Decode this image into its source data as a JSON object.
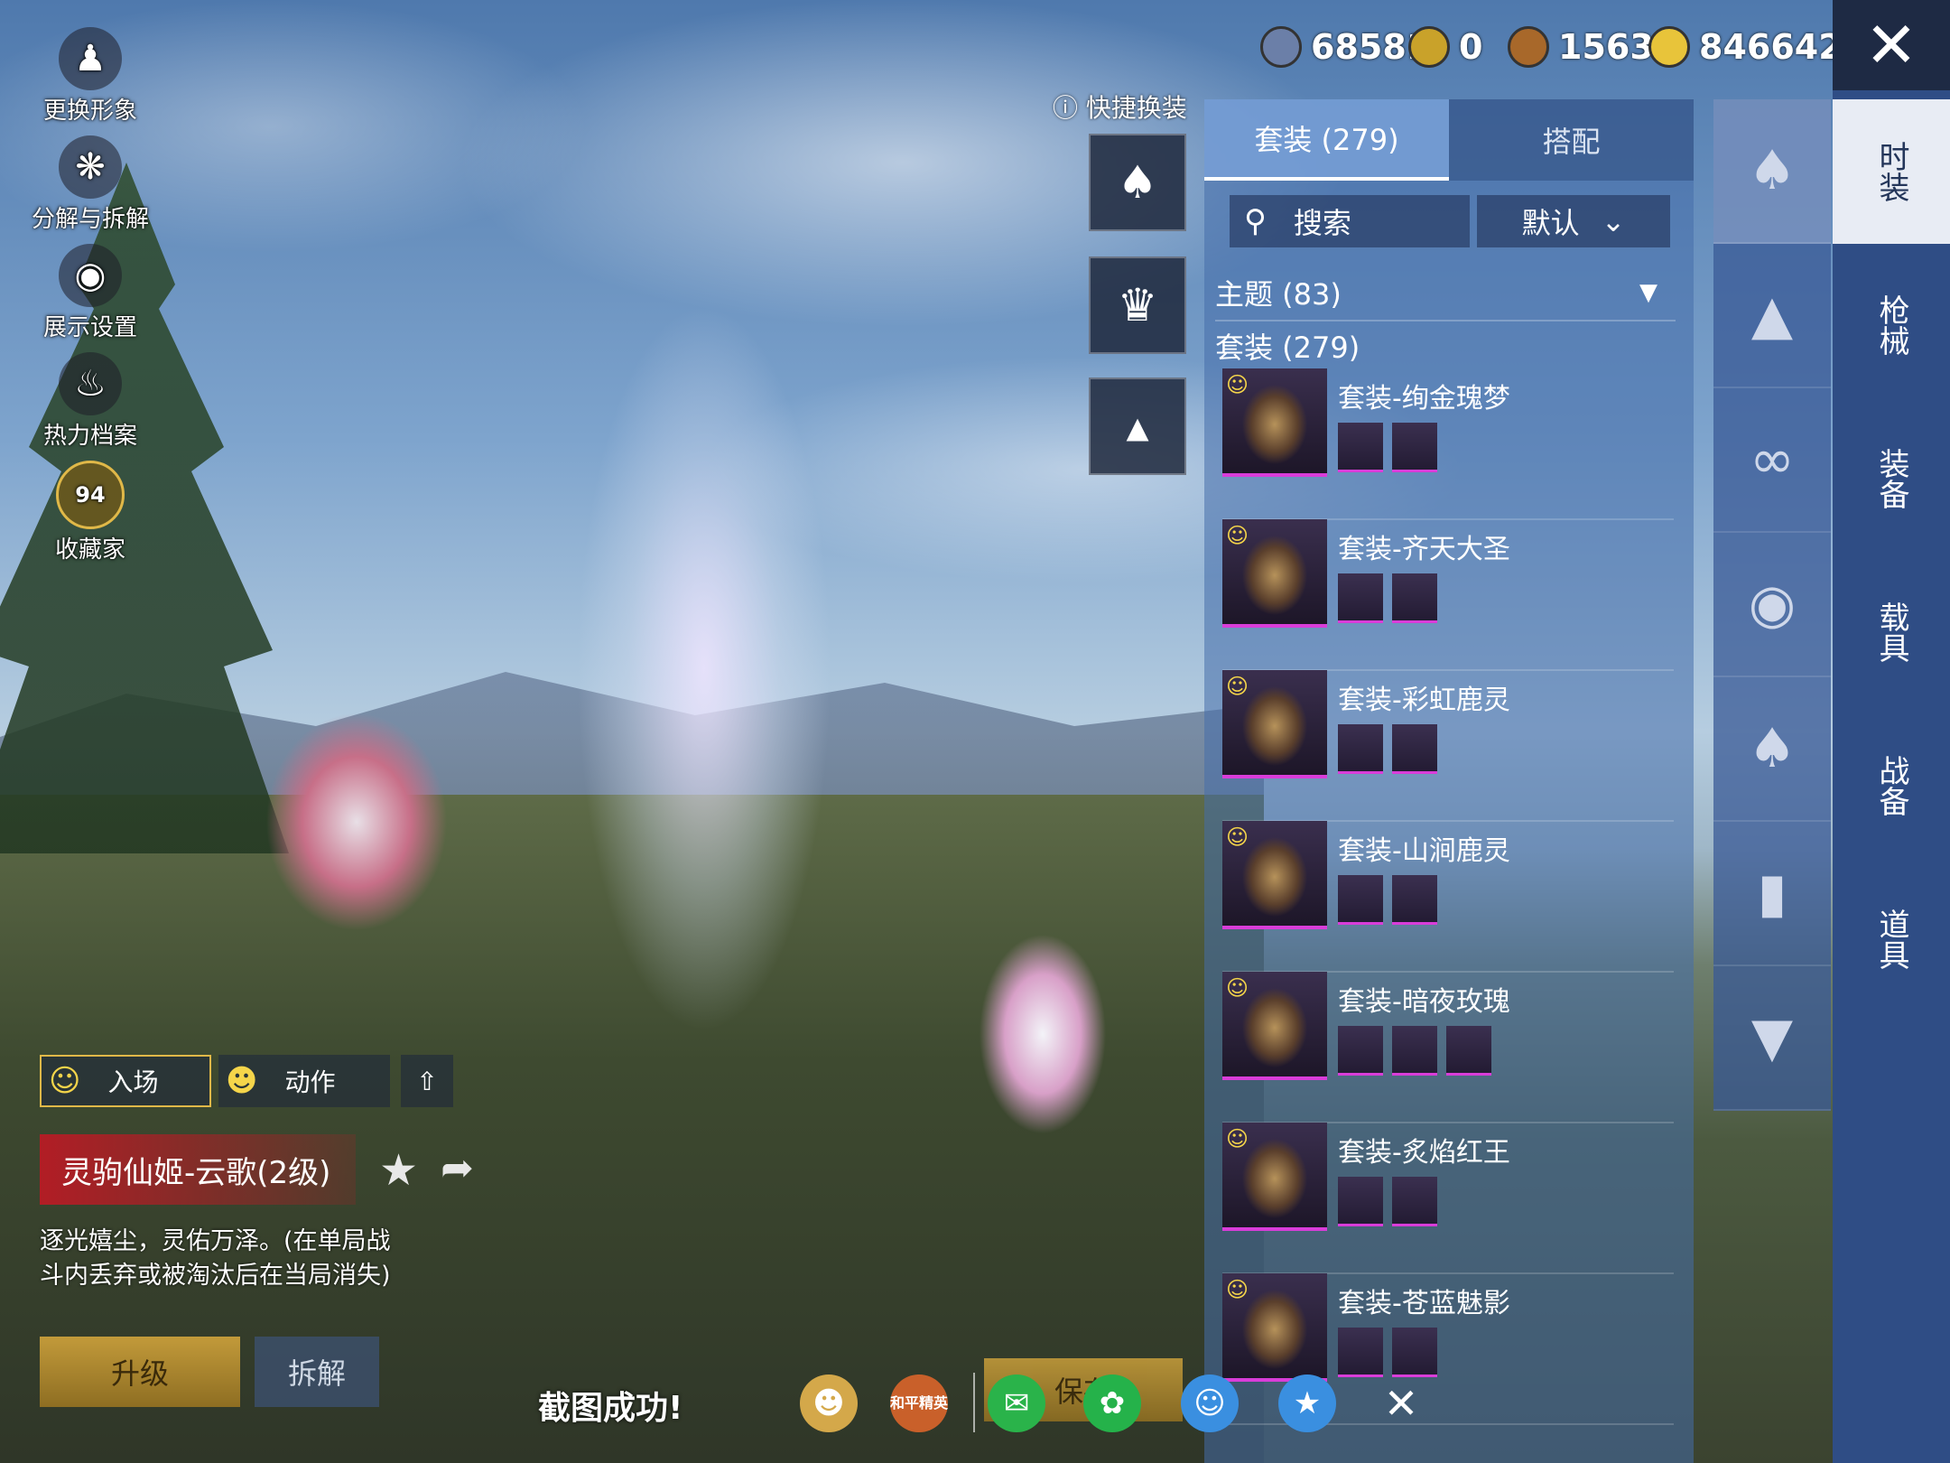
{
  "tools": [
    {
      "label": "更换形象",
      "icon": "avatar-icon"
    },
    {
      "label": "分解与拆解",
      "icon": "puzzle-icon"
    },
    {
      "label": "展示设置",
      "icon": "eye-icon"
    },
    {
      "label": "热力档案",
      "icon": "flame-icon"
    },
    {
      "label": "收藏家",
      "icon": "collector-badge-icon",
      "badge": "94"
    }
  ],
  "currency": [
    {
      "value": "68581",
      "color": "#6b7fa8"
    },
    {
      "value": "0",
      "color": "#c9a22a"
    },
    {
      "value": "1563",
      "color": "#a8682a"
    },
    {
      "value": "846642",
      "color": "#e8c43a"
    }
  ],
  "quick_change": {
    "label": "快捷换装"
  },
  "side_tabs": [
    "时装",
    "枪械",
    "装备",
    "载具",
    "战备",
    "道具"
  ],
  "panel": {
    "tabs": [
      "套装 (279)",
      "搭配"
    ],
    "search_label": "搜索",
    "sort_label": "默认",
    "theme_label": "主题 (83)",
    "suit_header": "套装 (279)",
    "items": [
      {
        "name": "套装-绚金瑰梦",
        "subs": 2
      },
      {
        "name": "套装-齐天大圣",
        "subs": 2
      },
      {
        "name": "套装-彩虹鹿灵",
        "subs": 2
      },
      {
        "name": "套装-山涧鹿灵",
        "subs": 2
      },
      {
        "name": "套装-暗夜玫瑰",
        "subs": 3
      },
      {
        "name": "套装-炙焰红王",
        "subs": 2
      },
      {
        "name": "套装-苍蓝魅影",
        "subs": 2
      }
    ]
  },
  "actions": {
    "entry": "入场",
    "motion": "动作"
  },
  "item_name": "灵驹仙姬-云歌(2级)",
  "item_desc": "逐光嬉尘，灵佑万泽。(在单局战斗内丢弃或被淘汰后在当局消失)",
  "buttons": {
    "upgrade": "升级",
    "disassemble": "拆解",
    "save": "保存"
  },
  "toast": "截图成功!",
  "share_logo_text": "和平精英"
}
